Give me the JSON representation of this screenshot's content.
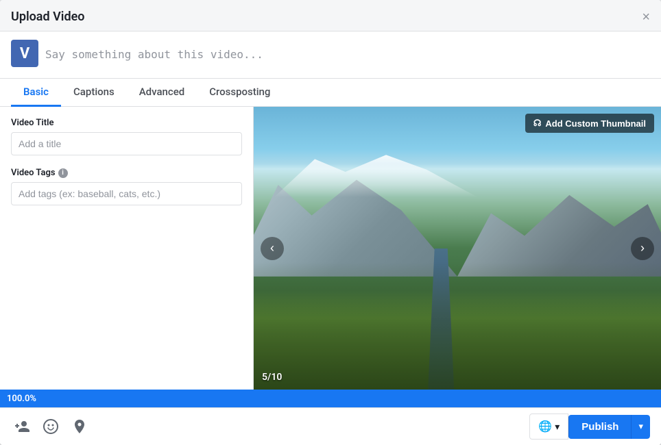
{
  "modal": {
    "title": "Upload Video",
    "close_label": "×"
  },
  "post": {
    "placeholder": "Say something about this video..."
  },
  "avatar": {
    "letter": "V"
  },
  "tabs": [
    {
      "id": "basic",
      "label": "Basic",
      "active": true
    },
    {
      "id": "captions",
      "label": "Captions",
      "active": false
    },
    {
      "id": "advanced",
      "label": "Advanced",
      "active": false
    },
    {
      "id": "crossposting",
      "label": "Crossposting",
      "active": false
    }
  ],
  "form": {
    "title_label": "Video Title",
    "title_placeholder": "Add a title",
    "tags_label": "Video Tags",
    "tags_info": "i",
    "tags_placeholder": "Add tags (ex: baseball, cats, etc.)"
  },
  "video": {
    "thumbnail_btn": "Add Custom Thumbnail",
    "slide_counter": "5/10"
  },
  "progress": {
    "value": "100.0%"
  },
  "footer": {
    "icons": [
      {
        "name": "tag-people-icon",
        "unicode": "👤"
      },
      {
        "name": "emoji-icon",
        "unicode": "😊"
      },
      {
        "name": "location-icon",
        "unicode": "📍"
      }
    ],
    "audience_globe": "🌐",
    "audience_arrow": "▾",
    "publish_label": "Publish",
    "dropdown_arrow": "▾"
  }
}
